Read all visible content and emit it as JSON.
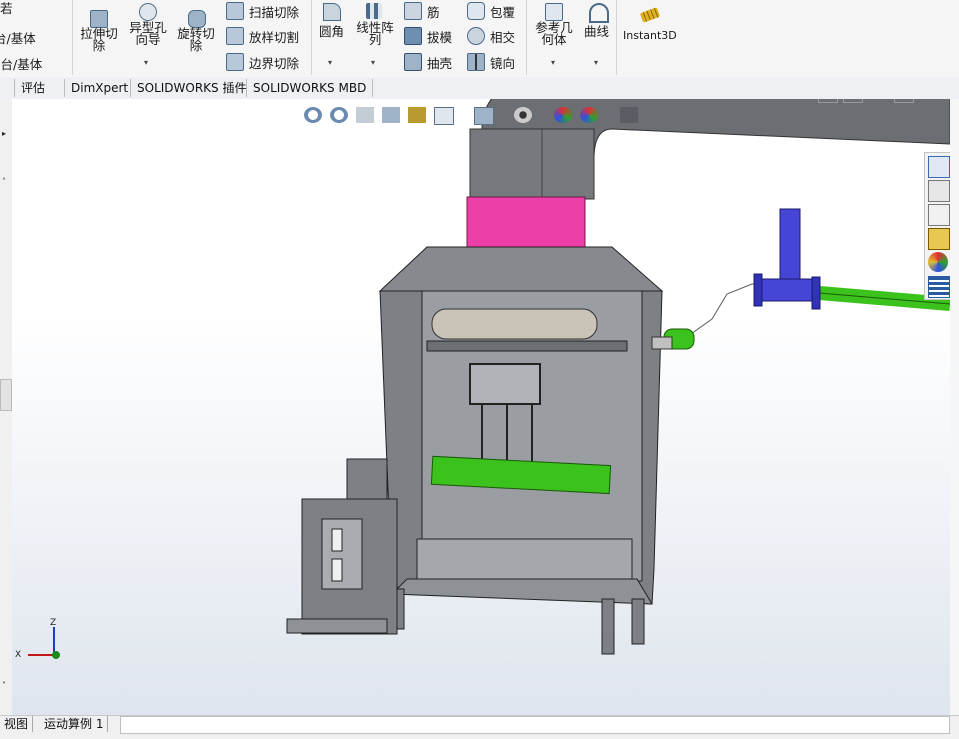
{
  "ribbon": {
    "left_items": [
      {
        "label": "台/基体"
      },
      {
        "label": "凸台/基体"
      }
    ],
    "partial_top": "若",
    "extrude_cut": {
      "line1": "拉伸切",
      "line2": "除"
    },
    "hole_wizard": {
      "line1": "异型孔",
      "line2": "向导"
    },
    "revolve_cut": {
      "line1": "旋转切",
      "line2": "除"
    },
    "sweep_cut": "扫描切除",
    "loft_cut": "放样切割",
    "boundary_cut": "边界切除",
    "fillet": "圆角",
    "linear_pattern": {
      "line1": "线性阵",
      "line2": "列"
    },
    "rib": "筋",
    "draft": "拔模",
    "shell": "抽壳",
    "wrap": "包覆",
    "intersect": "相交",
    "mirror": "镜向",
    "ref_geometry": {
      "line1": "参考几",
      "line2": "何体"
    },
    "curves": "曲线",
    "instant3d": "Instant3D"
  },
  "tabs": [
    "评估",
    "DimXpert",
    "SOLIDWORKS 插件",
    "SOLIDWORKS MBD"
  ],
  "bottom_tabs": [
    "视图",
    "运动算例 1"
  ],
  "triad": {
    "x": "X",
    "z": "Z"
  },
  "colors": {
    "pipe_gray": "#6b6e72",
    "collar_pink": "#ee3fa8",
    "pipe_green": "#3cc21c",
    "valve_blue": "#4646d6",
    "frame_gray": "#8a8d92"
  }
}
